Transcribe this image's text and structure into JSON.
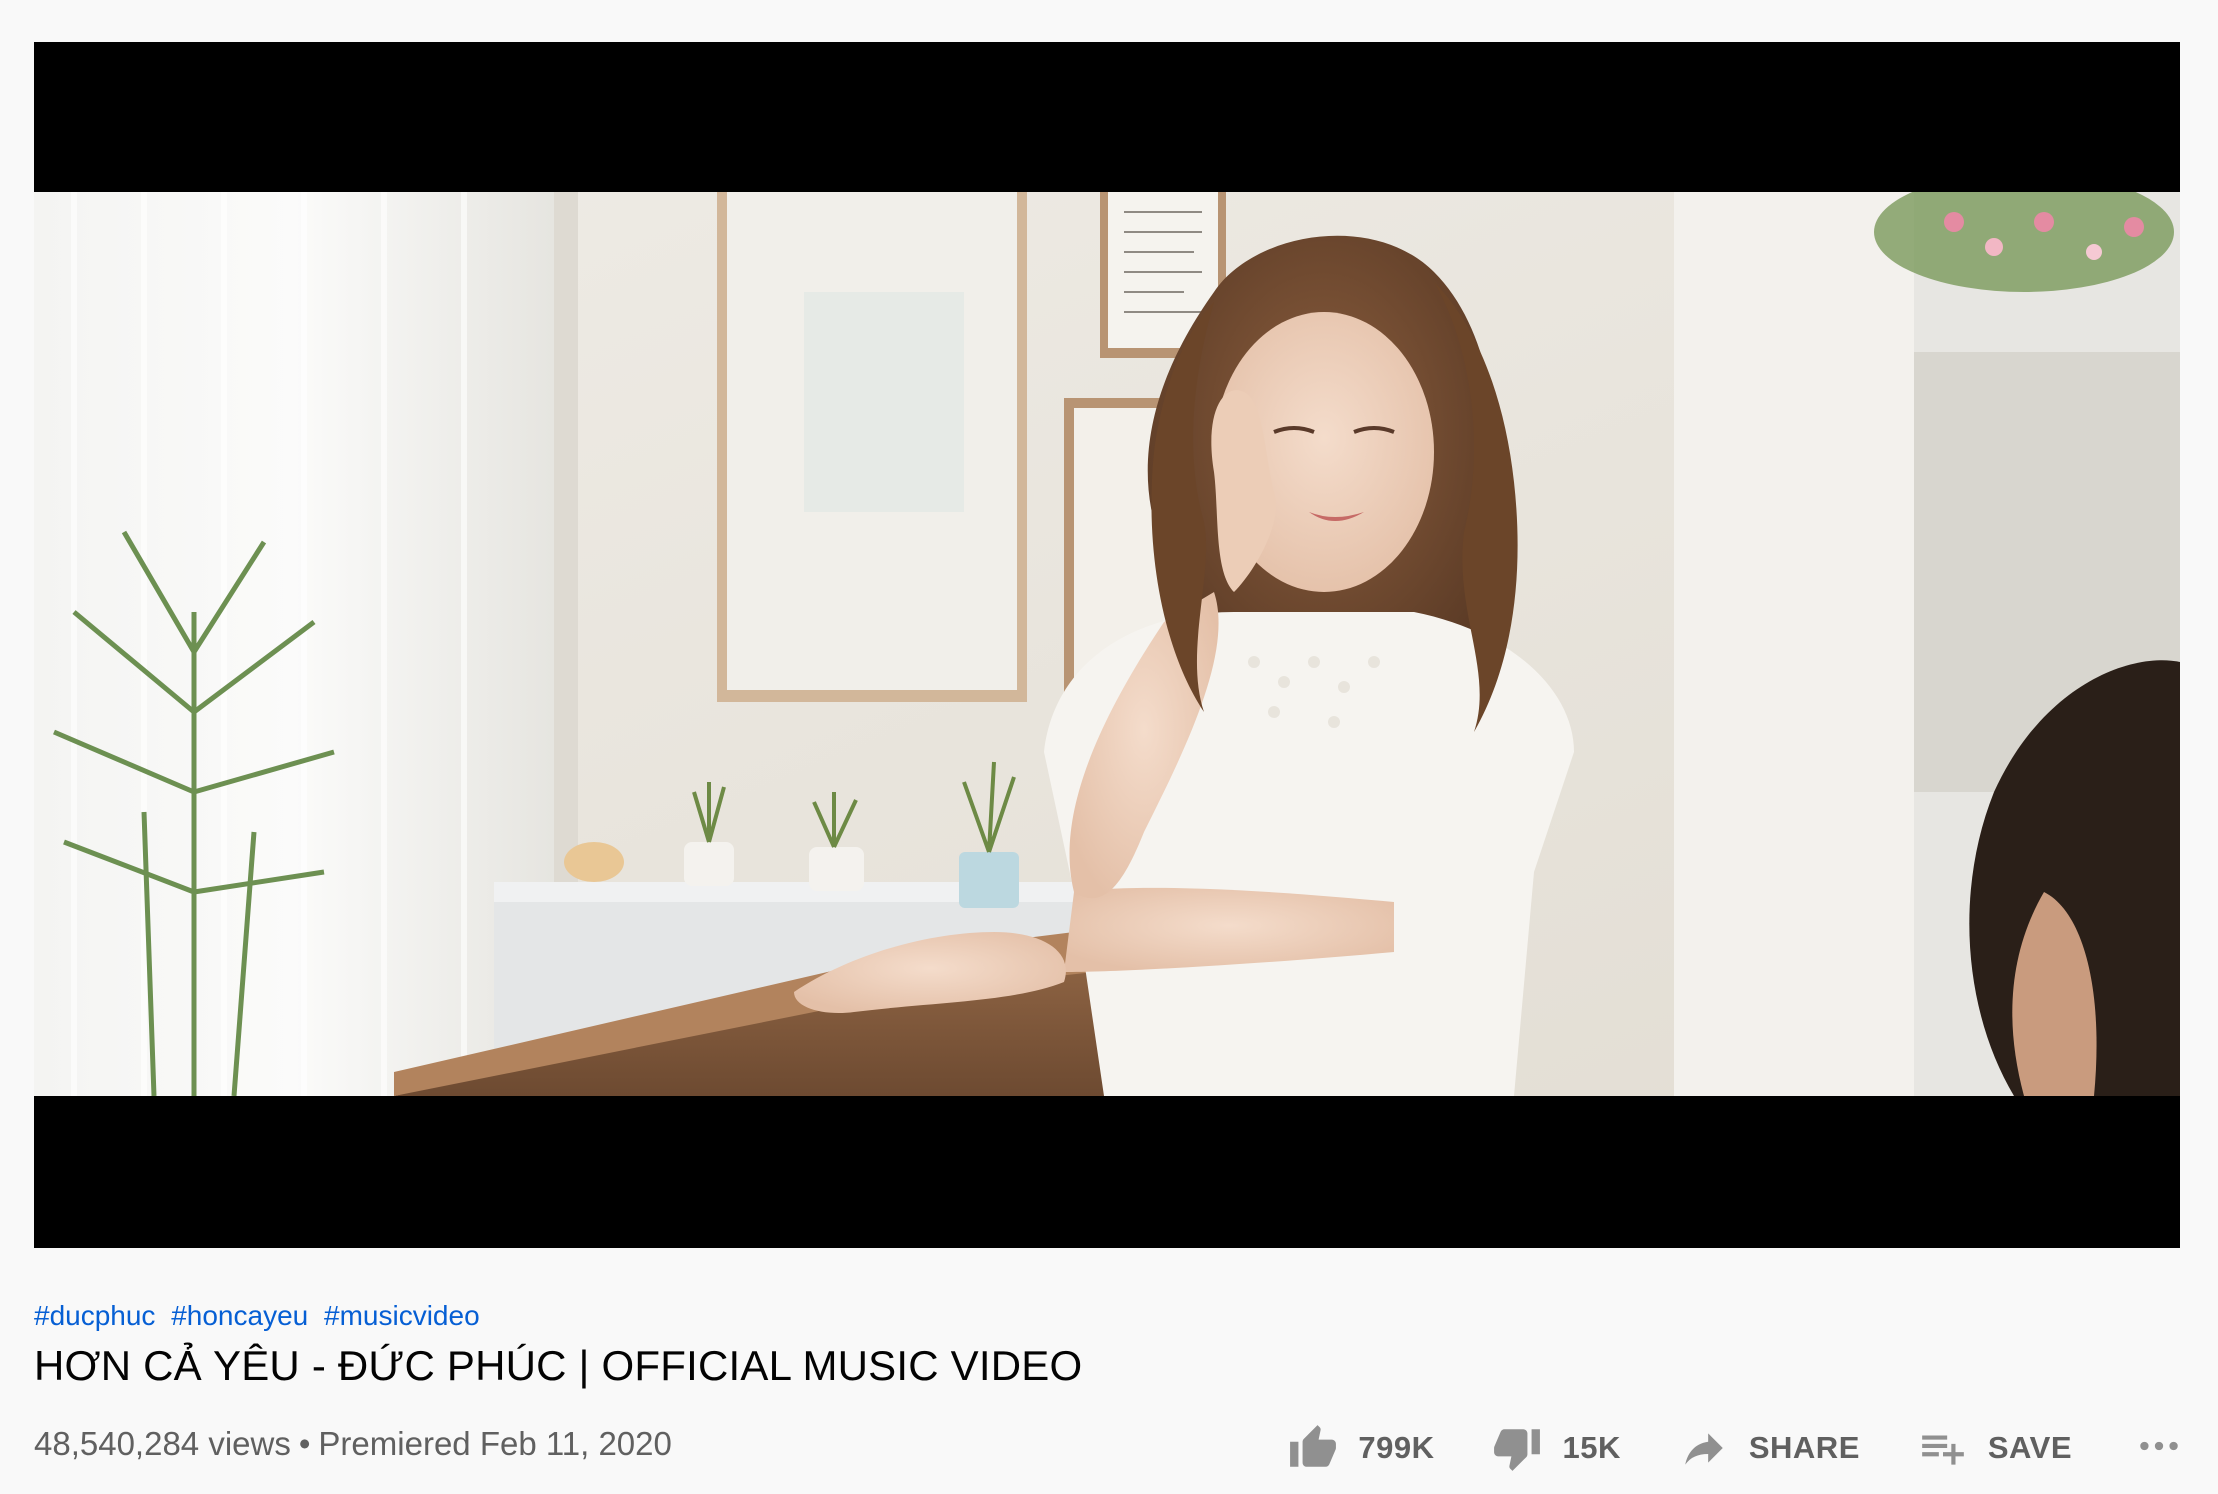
{
  "video": {
    "hashtags": [
      "#ducphuc",
      "#honcayeu",
      "#musicvideo"
    ],
    "title": "HƠN CẢ YÊU - ĐỨC PHÚC | OFFICIAL MUSIC VIDEO",
    "views": "48,540,284 views",
    "separator": "•",
    "premiered": "Premiered Feb 11, 2020"
  },
  "actions": {
    "like": {
      "label": "799K",
      "icon": "thumb-up-icon"
    },
    "dislike": {
      "label": "15K",
      "icon": "thumb-down-icon"
    },
    "share": {
      "label": "SHARE",
      "icon": "share-arrow-icon"
    },
    "save": {
      "label": "SAVE",
      "icon": "playlist-add-icon"
    },
    "more": {
      "icon": "more-horizontal-icon"
    }
  },
  "colors": {
    "hashtag": "#065fd4",
    "secondary_text": "#606060",
    "icon": "#909090",
    "background": "#f9f9f9",
    "letterbox": "#000000"
  }
}
